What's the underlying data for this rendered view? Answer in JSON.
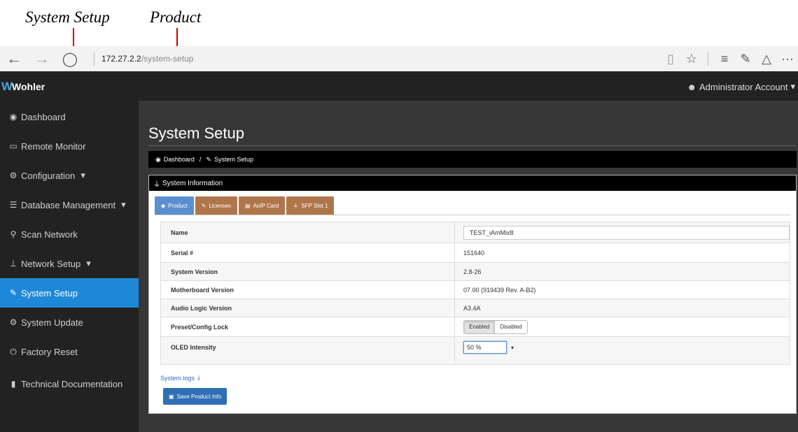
{
  "callouts": {
    "system_setup": "System Setup",
    "product": "Product"
  },
  "browser": {
    "url_host": "172.27.2.2",
    "url_path": "/system-setup",
    "icons": [
      "back-icon",
      "forward-icon",
      "refresh-icon",
      "reading-view-icon",
      "favorite-star-icon",
      "hub-icon",
      "notes-icon",
      "share-icon",
      "more-icon"
    ]
  },
  "header": {
    "logo": "Wohler",
    "account": "Administrator Account"
  },
  "sidebar": {
    "items": [
      {
        "label": "Dashboard",
        "icon": "dashboard-icon"
      },
      {
        "label": "Remote Monitor",
        "icon": "monitor-icon"
      },
      {
        "label": "Configuration",
        "icon": "cogs-icon",
        "caret": "▾"
      },
      {
        "label": "Database Management",
        "icon": "database-icon",
        "caret": "▾"
      },
      {
        "label": "Scan Network",
        "icon": "search-icon"
      },
      {
        "label": "Network Setup",
        "icon": "sitemap-icon",
        "caret": "▾"
      },
      {
        "label": "System Setup",
        "icon": "wrench-icon",
        "active": true
      },
      {
        "label": "System Update",
        "icon": "gear-icon"
      },
      {
        "label": "Factory Reset",
        "icon": "power-icon"
      },
      {
        "label": "Technical Documentation",
        "icon": "book-icon"
      }
    ]
  },
  "main": {
    "title": "System Setup",
    "breadcrumb": {
      "home": "Dashboard",
      "sep": "/",
      "current": "System Setup"
    },
    "panel_title": "System Information",
    "tabs": [
      {
        "label": "Product",
        "active": true
      },
      {
        "label": "Licenses"
      },
      {
        "label": "AoIP Card"
      },
      {
        "label": "SFP Slot 1"
      }
    ],
    "rows": {
      "name": {
        "label": "Name",
        "value": "TEST_iAmMix8"
      },
      "serial": {
        "label": "Serial #",
        "value": "151640"
      },
      "system_version": {
        "label": "System Version",
        "value": "2.8-26"
      },
      "motherboard": {
        "label": "Motherboard Version",
        "value": "07.00 (919439 Rev. A-B2)"
      },
      "audio_logic": {
        "label": "Audio Logic Version",
        "value": "A3.4A"
      },
      "lock": {
        "label": "Preset/Config Lock",
        "enabled": "Enabled",
        "disabled": "Disabled",
        "selected": "Enabled"
      },
      "oled": {
        "label": "OLED Intensity",
        "value": "50 %"
      }
    },
    "system_logs": "System logs",
    "save_button": "Save Product Info"
  },
  "colors": {
    "accent": "#1e88d8",
    "tab_active": "#5a8fd0",
    "tab_inactive": "#b0764b",
    "callout": "#d40000"
  }
}
